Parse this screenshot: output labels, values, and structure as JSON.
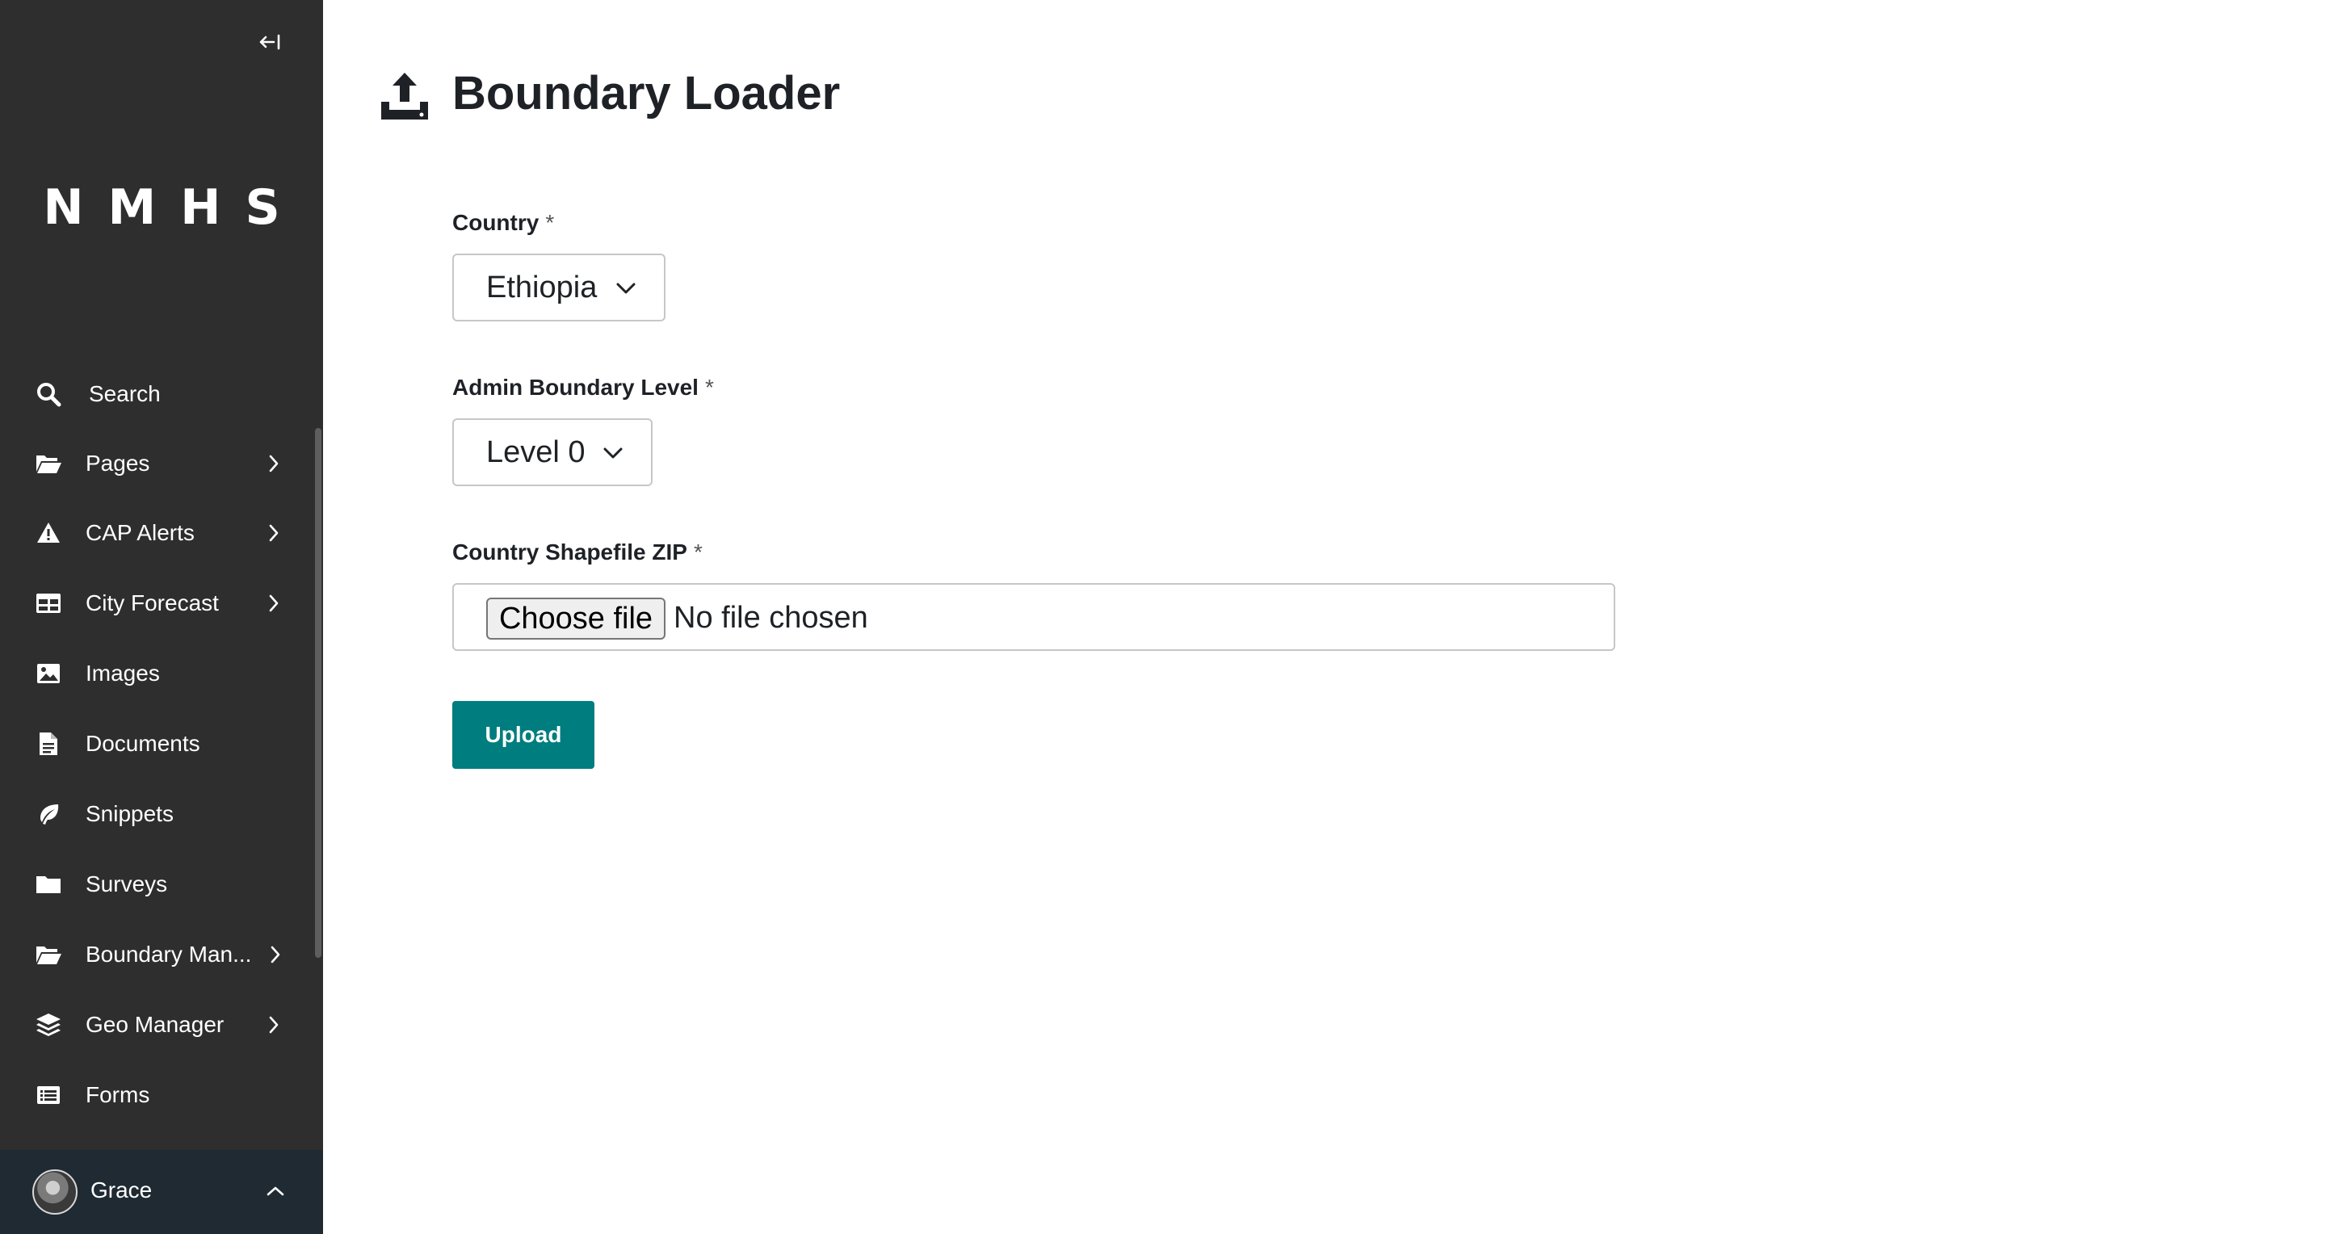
{
  "sidebar": {
    "collapse_icon": "collapse-left-icon",
    "logo": "NMHS",
    "items": [
      {
        "label": "Search",
        "icon": "search-icon",
        "has_submenu": false
      },
      {
        "label": "Pages",
        "icon": "folder-open-icon",
        "has_submenu": true
      },
      {
        "label": "CAP Alerts",
        "icon": "warning-icon",
        "has_submenu": true
      },
      {
        "label": "City Forecast",
        "icon": "table-icon",
        "has_submenu": true
      },
      {
        "label": "Images",
        "icon": "image-icon",
        "has_submenu": false
      },
      {
        "label": "Documents",
        "icon": "document-icon",
        "has_submenu": false
      },
      {
        "label": "Snippets",
        "icon": "snippet-icon",
        "has_submenu": false
      },
      {
        "label": "Surveys",
        "icon": "folder-icon",
        "has_submenu": false
      },
      {
        "label": "Boundary Man...",
        "icon": "folder-open-icon",
        "has_submenu": true
      },
      {
        "label": "Geo Manager",
        "icon": "layers-icon",
        "has_submenu": true
      },
      {
        "label": "Forms",
        "icon": "list-icon",
        "has_submenu": false
      }
    ],
    "account": {
      "name": "Grace",
      "chevron": "chevron-up-icon"
    }
  },
  "main": {
    "title": "Boundary Loader",
    "title_icon": "upload-icon",
    "form": {
      "country": {
        "label": "Country",
        "required_mark": "*",
        "value": "Ethiopia"
      },
      "admin_level": {
        "label": "Admin Boundary Level",
        "required_mark": "*",
        "value": "Level 0"
      },
      "shapefile": {
        "label": "Country Shapefile ZIP",
        "required_mark": "*",
        "button_label": "Choose file",
        "status": "No file chosen"
      },
      "submit_label": "Upload"
    }
  },
  "colors": {
    "sidebar_bg": "#2e2e2e",
    "account_bg": "#1f2a33",
    "primary": "#007d7e",
    "text": "#1e2227"
  }
}
